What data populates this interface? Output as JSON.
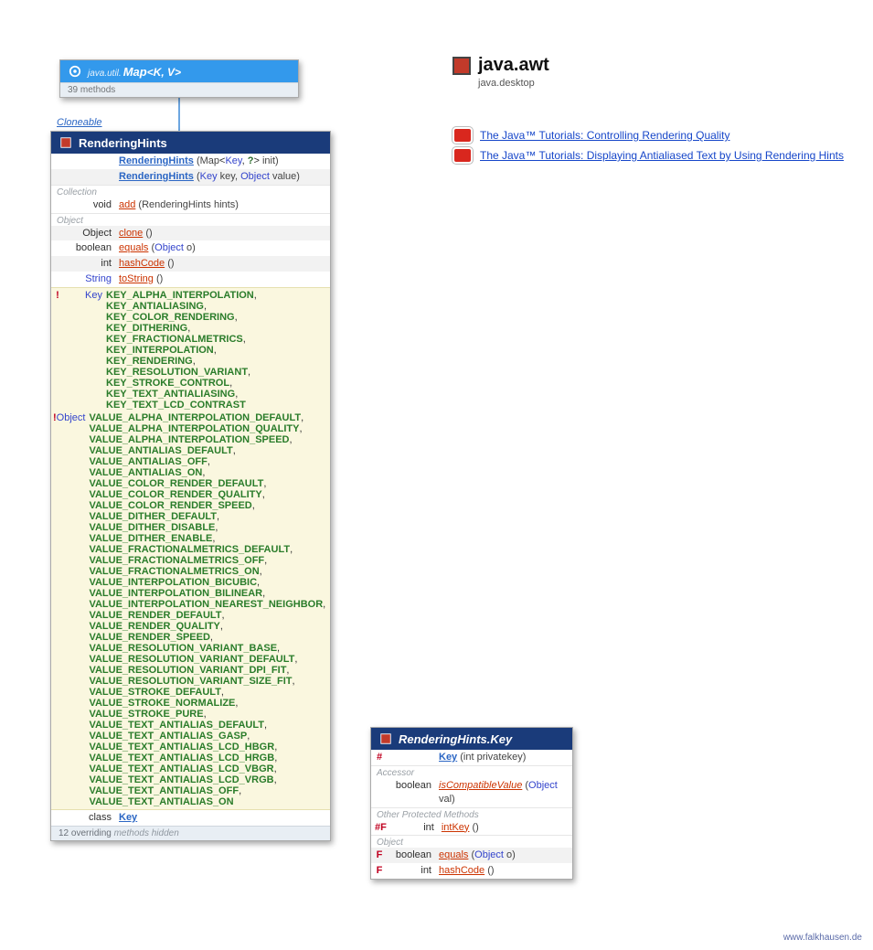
{
  "package": {
    "name": "java.awt",
    "module": "java.desktop"
  },
  "resources": [
    "The Java™ Tutorials: Controlling Rendering Quality",
    "The Java™ Tutorials: Displaying Antialiased Text by Using Rendering Hints"
  ],
  "mapbox": {
    "pkg": "java.util.",
    "name": "Map",
    "params": "<K, V>",
    "sub": "39 methods"
  },
  "iface_label": "Cloneable",
  "mainbox": {
    "title": "RenderingHints",
    "constructors": [
      {
        "sig_parts": [
          "RenderingHints",
          " (Map",
          "<",
          "Key",
          ",",
          " ?",
          ">",
          " init)"
        ]
      },
      {
        "sig_parts": [
          "RenderingHints",
          " (",
          "Key",
          " key, ",
          "Object",
          " value)"
        ]
      }
    ],
    "sections": [
      {
        "label": "Collection",
        "rows": [
          {
            "ret": "void",
            "name": "add",
            "args": " (RenderingHints hints)",
            "alt": false
          }
        ]
      },
      {
        "label": "Object",
        "rows": [
          {
            "ret": "Object",
            "name": "clone",
            "args": " ()",
            "alt": true
          },
          {
            "ret": "boolean",
            "name": "equals",
            "args_parts": [
              " (",
              "Object",
              " o)"
            ],
            "alt": false
          },
          {
            "ret": "int",
            "name": "hashCode",
            "args": " ()",
            "alt": true
          },
          {
            "ret": "String",
            "name": "toString",
            "args": " ()",
            "alt": false,
            "ret_type": true
          }
        ]
      }
    ],
    "key_constants": [
      "KEY_ALPHA_INTERPOLATION",
      "KEY_ANTIALIASING",
      "KEY_COLOR_RENDERING",
      "KEY_DITHERING",
      "KEY_FRACTIONALMETRICS",
      "KEY_INTERPOLATION",
      "KEY_RENDERING",
      "KEY_RESOLUTION_VARIANT",
      "KEY_STROKE_CONTROL",
      "KEY_TEXT_ANTIALIASING",
      "KEY_TEXT_LCD_CONTRAST"
    ],
    "value_constants": [
      "VALUE_ALPHA_INTERPOLATION_DEFAULT",
      "VALUE_ALPHA_INTERPOLATION_QUALITY",
      "VALUE_ALPHA_INTERPOLATION_SPEED",
      "VALUE_ANTIALIAS_DEFAULT",
      "VALUE_ANTIALIAS_OFF",
      "VALUE_ANTIALIAS_ON",
      "VALUE_COLOR_RENDER_DEFAULT",
      "VALUE_COLOR_RENDER_QUALITY",
      "VALUE_COLOR_RENDER_SPEED",
      "VALUE_DITHER_DEFAULT",
      "VALUE_DITHER_DISABLE",
      "VALUE_DITHER_ENABLE",
      "VALUE_FRACTIONALMETRICS_DEFAULT",
      "VALUE_FRACTIONALMETRICS_OFF",
      "VALUE_FRACTIONALMETRICS_ON",
      "VALUE_INTERPOLATION_BICUBIC",
      "VALUE_INTERPOLATION_BILINEAR",
      "VALUE_INTERPOLATION_NEAREST_NEIGHBOR",
      "VALUE_RENDER_DEFAULT",
      "VALUE_RENDER_QUALITY",
      "VALUE_RENDER_SPEED",
      "VALUE_RESOLUTION_VARIANT_BASE",
      "VALUE_RESOLUTION_VARIANT_DEFAULT",
      "VALUE_RESOLUTION_VARIANT_DPI_FIT",
      "VALUE_RESOLUTION_VARIANT_SIZE_FIT",
      "VALUE_STROKE_DEFAULT",
      "VALUE_STROKE_NORMALIZE",
      "VALUE_STROKE_PURE",
      "VALUE_TEXT_ANTIALIAS_DEFAULT",
      "VALUE_TEXT_ANTIALIAS_GASP",
      "VALUE_TEXT_ANTIALIAS_LCD_HBGR",
      "VALUE_TEXT_ANTIALIAS_LCD_HRGB",
      "VALUE_TEXT_ANTIALIAS_LCD_VBGR",
      "VALUE_TEXT_ANTIALIAS_LCD_VRGB",
      "VALUE_TEXT_ANTIALIAS_OFF",
      "VALUE_TEXT_ANTIALIAS_ON"
    ],
    "innerclass": {
      "label": "class",
      "name": "Key"
    },
    "footer": {
      "lead": "12 overriding",
      "rest": " methods hidden"
    }
  },
  "keybox": {
    "title": "RenderingHints.Key",
    "ctor": {
      "flag": "#",
      "name": "Key",
      "args": " (int privatekey)"
    },
    "sections": [
      {
        "label": "Accessor",
        "rows": [
          {
            "ret": "boolean",
            "name": "isCompatibleValue",
            "abs": true,
            "args_parts": [
              " (",
              "Object",
              " val)"
            ]
          }
        ]
      },
      {
        "label": "Other Protected Methods",
        "rows": [
          {
            "flag": "#F",
            "ret": "int",
            "name": "intKey",
            "args": " ()"
          }
        ]
      },
      {
        "label": "Object",
        "rows": [
          {
            "flag": "F",
            "ret": "boolean",
            "name": "equals",
            "args_parts": [
              " (",
              "Object",
              " o)"
            ],
            "alt": true
          },
          {
            "flag": "F",
            "ret": "int",
            "name": "hashCode",
            "args": " ()"
          }
        ]
      }
    ]
  },
  "watermark": "www.falkhausen.de"
}
